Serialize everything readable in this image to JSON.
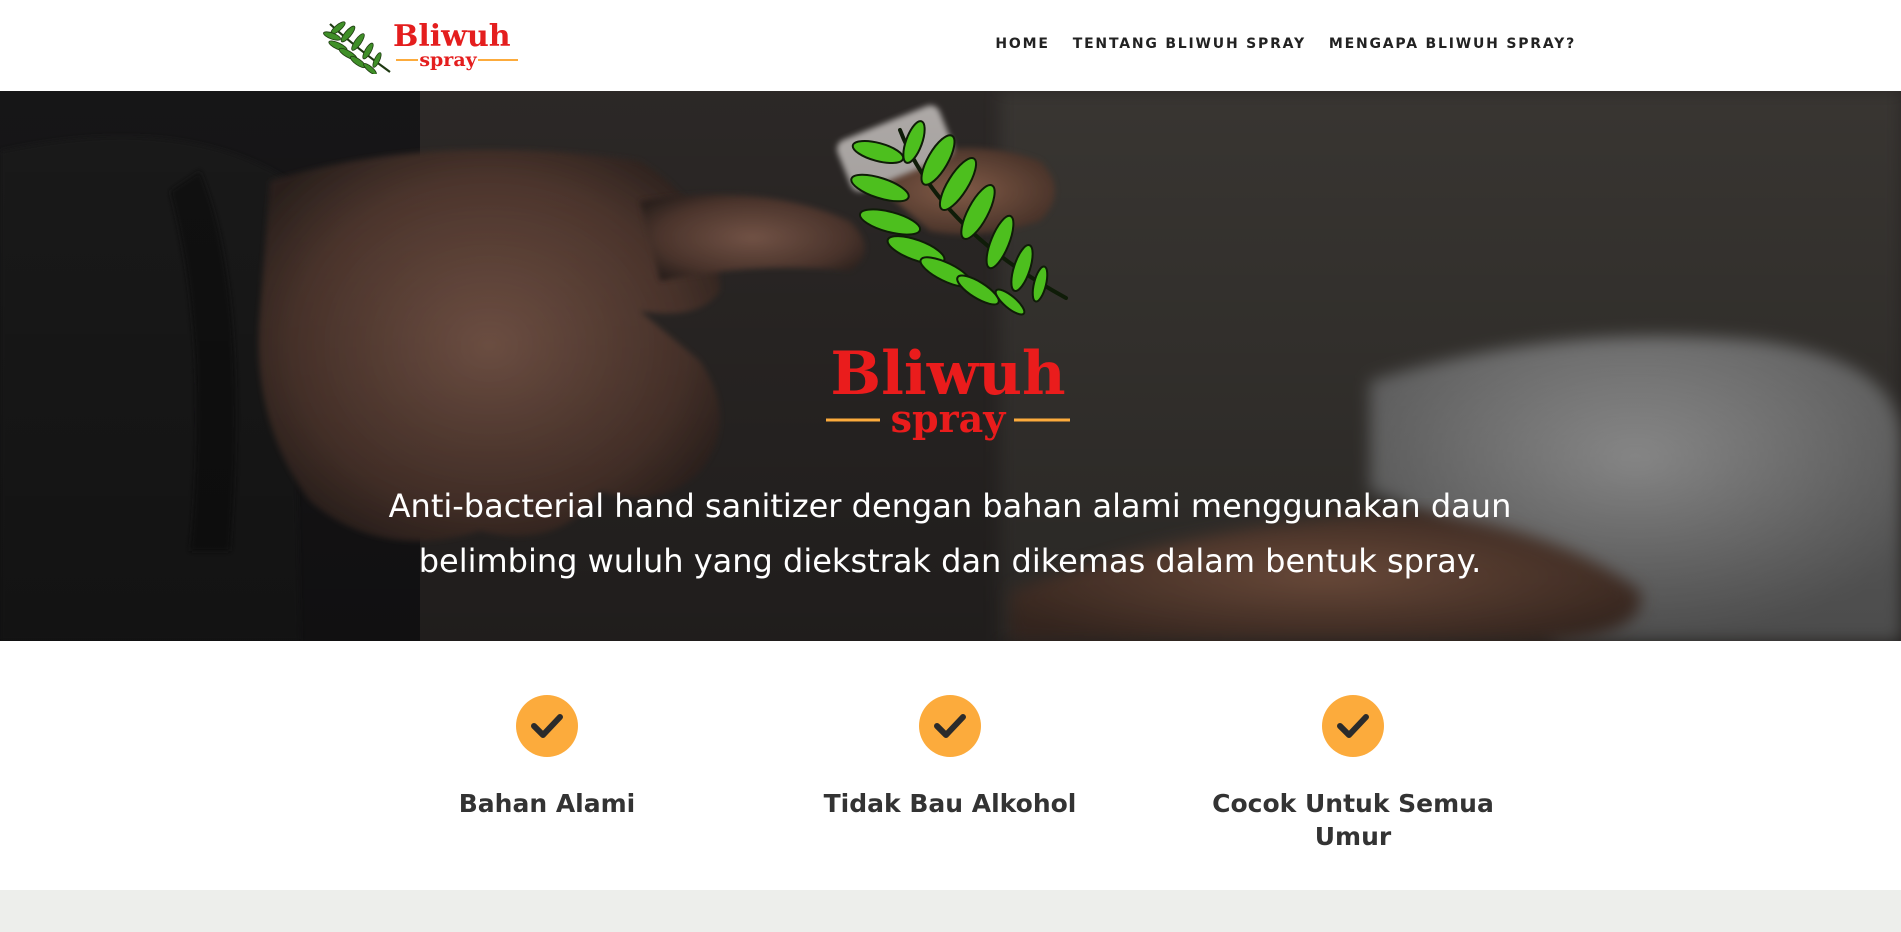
{
  "header": {
    "logo": {
      "icon": "leaf-logo-icon",
      "wordmark": "Bliwuh",
      "subword": "spray"
    },
    "nav": [
      {
        "label": "HOME"
      },
      {
        "label": "TENTANG BLIWUH SPRAY"
      },
      {
        "label": "MENGAPA BLIWUH SPRAY?"
      }
    ]
  },
  "hero": {
    "emblem": {
      "icon": "leaf-emblem-icon",
      "wordmark": "Bliwuh",
      "subword": "spray"
    },
    "tagline": "Anti-bacterial hand sanitizer dengan bahan alami menggunakan daun belimbing wuluh yang diekstrak dan dikemas dalam bentuk spray."
  },
  "features": [
    {
      "icon": "check-icon",
      "title": "Bahan Alami"
    },
    {
      "icon": "check-icon",
      "title": "Tidak Bau Alkohol"
    },
    {
      "icon": "check-icon",
      "title": "Cocok Untuk Semua Umur"
    }
  ],
  "colors": {
    "brand_red": "#e41e1e",
    "accent_orange": "#fcab3c",
    "leaf_green": "#5cbf2a",
    "text_dark": "#333333"
  }
}
